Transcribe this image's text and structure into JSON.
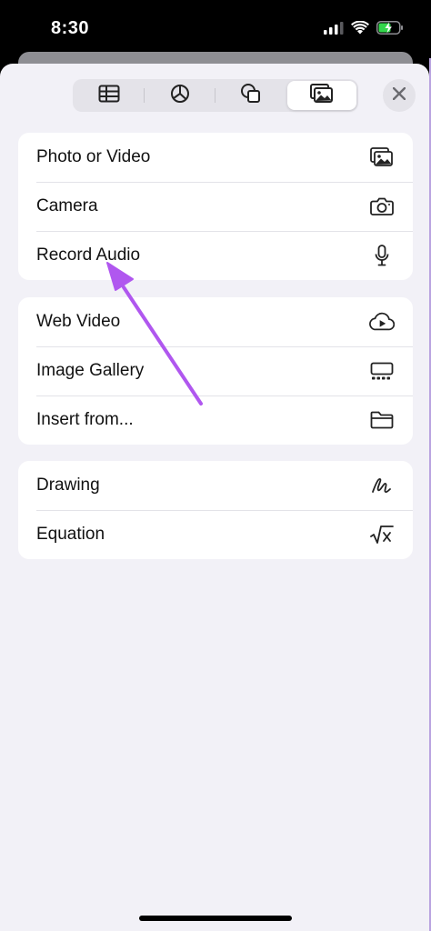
{
  "status_bar": {
    "time": "8:30",
    "icons": [
      "signal-icon",
      "wifi-icon",
      "battery-charging-icon"
    ]
  },
  "segments": [
    {
      "icon": "table-icon",
      "active": false
    },
    {
      "icon": "chart-icon",
      "active": false
    },
    {
      "icon": "shapes-icon",
      "active": false
    },
    {
      "icon": "media-icon",
      "active": true
    }
  ],
  "close_icon": "close-icon",
  "groups": [
    {
      "items": [
        {
          "label": "Photo or Video",
          "icon": "photo-icon"
        },
        {
          "label": "Camera",
          "icon": "camera-icon"
        },
        {
          "label": "Record Audio",
          "icon": "microphone-icon"
        }
      ]
    },
    {
      "items": [
        {
          "label": "Web Video",
          "icon": "cloud-play-icon"
        },
        {
          "label": "Image Gallery",
          "icon": "gallery-icon"
        },
        {
          "label": "Insert from...",
          "icon": "folder-icon"
        }
      ]
    },
    {
      "items": [
        {
          "label": "Drawing",
          "icon": "drawing-icon"
        },
        {
          "label": "Equation",
          "icon": "equation-icon"
        }
      ]
    }
  ],
  "colors": {
    "sheet_background": "#f2f1f7",
    "row_background": "#ffffff",
    "annotation_arrow": "#b057ef"
  }
}
